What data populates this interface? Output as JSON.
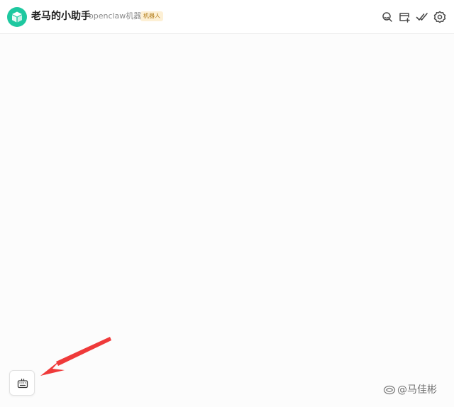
{
  "header": {
    "title": "老马的小助手",
    "subtitle": "openclaw机器人",
    "badge": "机器人",
    "avatar_color": "#1ec8a0",
    "badge_bg_color": "#fdf0d5",
    "badge_text_color": "#b07a17",
    "icons": [
      "search-icon",
      "add-window-icon",
      "done-all-icon",
      "gear-icon"
    ]
  },
  "main": {
    "background_color": "#fcfcfc"
  },
  "floating_button": {
    "icon": "keyboard-icon"
  },
  "annotation": {
    "arrow_color": "#ef3a3a"
  },
  "watermark": {
    "text": "@马佳彬"
  }
}
